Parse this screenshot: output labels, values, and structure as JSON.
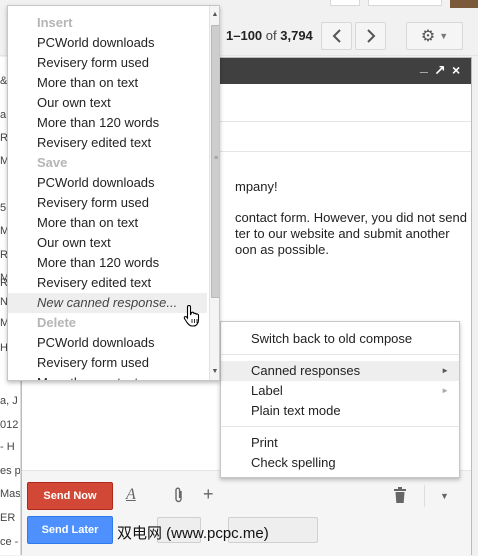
{
  "toolbar": {
    "page_range": "1–100",
    "page_of": "of",
    "page_total": "3,794",
    "prev_icon": "chevron-left",
    "next_icon": "chevron-right",
    "settings_icon": "gear"
  },
  "left_strip": [
    "&",
    "a",
    "R",
    "M",
    "5",
    "M",
    "R",
    "M",
    "R",
    "N",
    "M",
    "H",
    "a, J",
    "012",
    "- H",
    "es p",
    "Mas",
    "ER",
    "ce -"
  ],
  "compose": {
    "header_controls": [
      "_",
      "↗",
      "×"
    ],
    "body_lines": [
      "mpany!",
      "contact form. However, you did not send",
      "ter to our website and submit another",
      "oon as possible."
    ],
    "send_now": "Send Now",
    "send_later": "Send Later",
    "watermark": "双电网 (www.pcpc.me)"
  },
  "canned_menu": {
    "insert_heading": "Insert",
    "insert_items": [
      "PCWorld downloads",
      "Revisery form used",
      "More than on text",
      "Our own text",
      "More than 120 words",
      "Revisery edited text"
    ],
    "save_heading": "Save",
    "save_items": [
      "PCWorld downloads",
      "Revisery form used",
      "More than on text",
      "Our own text",
      "More than 120 words",
      "Revisery edited text"
    ],
    "new_response": "New canned response...",
    "delete_heading": "Delete",
    "delete_items": [
      "PCWorld downloads",
      "Revisery form used",
      "More than on text"
    ]
  },
  "options_menu": {
    "switch_compose": "Switch back to old compose",
    "canned_responses": "Canned responses",
    "label": "Label",
    "plain_text": "Plain text mode",
    "print": "Print",
    "check_spelling": "Check spelling"
  },
  "colors": {
    "send_now": "#d14836",
    "send_later": "#4d90fe",
    "compose_header": "#404040",
    "menu_heading": "#b5b5b5",
    "menu_highlight": "#eeeeee"
  }
}
